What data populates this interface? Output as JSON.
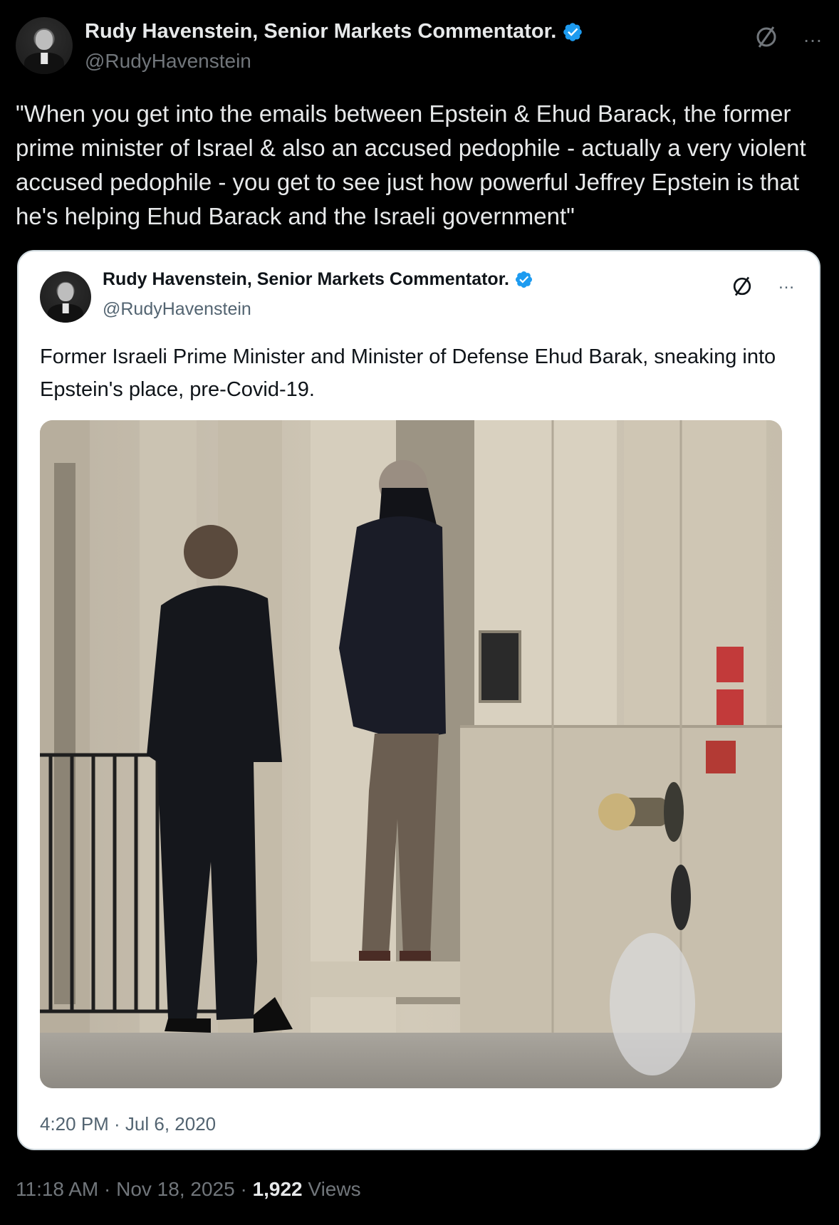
{
  "post": {
    "display_name": "Rudy Havenstein, Senior Markets Commentator.",
    "handle": "@RudyHavenstein",
    "text": "\"When you get into the emails between Epstein & Ehud Barack, the former prime minister of Israel & also an accused pedophile - actually a very violent accused pedophile - you get to see just how powerful Jeffrey Epstein is that he's helping Ehud Barack and the Israeli government\"",
    "timestamp": "11:18 AM · Nov 18, 2025 · ",
    "views_count": "1,922",
    "views_label": " Views",
    "more_icon": "…"
  },
  "quoted_post": {
    "display_name": "Rudy Havenstein, Senior Markets Commentator.",
    "handle": "@RudyHavenstein",
    "text": "Former Israeli Prime Minister and Minister of Defense Ehud Barak, sneaking into Epstein's place, pre-Covid-19.",
    "timestamp": "4:20 PM · Jul 6, 2020",
    "more_icon": "…",
    "photo_icon": "street-photo-two-men-stone-building"
  },
  "colors": {
    "background": "#000000",
    "text_primary": "#e7e9ea",
    "text_secondary": "#71767b",
    "verified_blue": "#1d9bf0",
    "card_background": "#ffffff"
  }
}
